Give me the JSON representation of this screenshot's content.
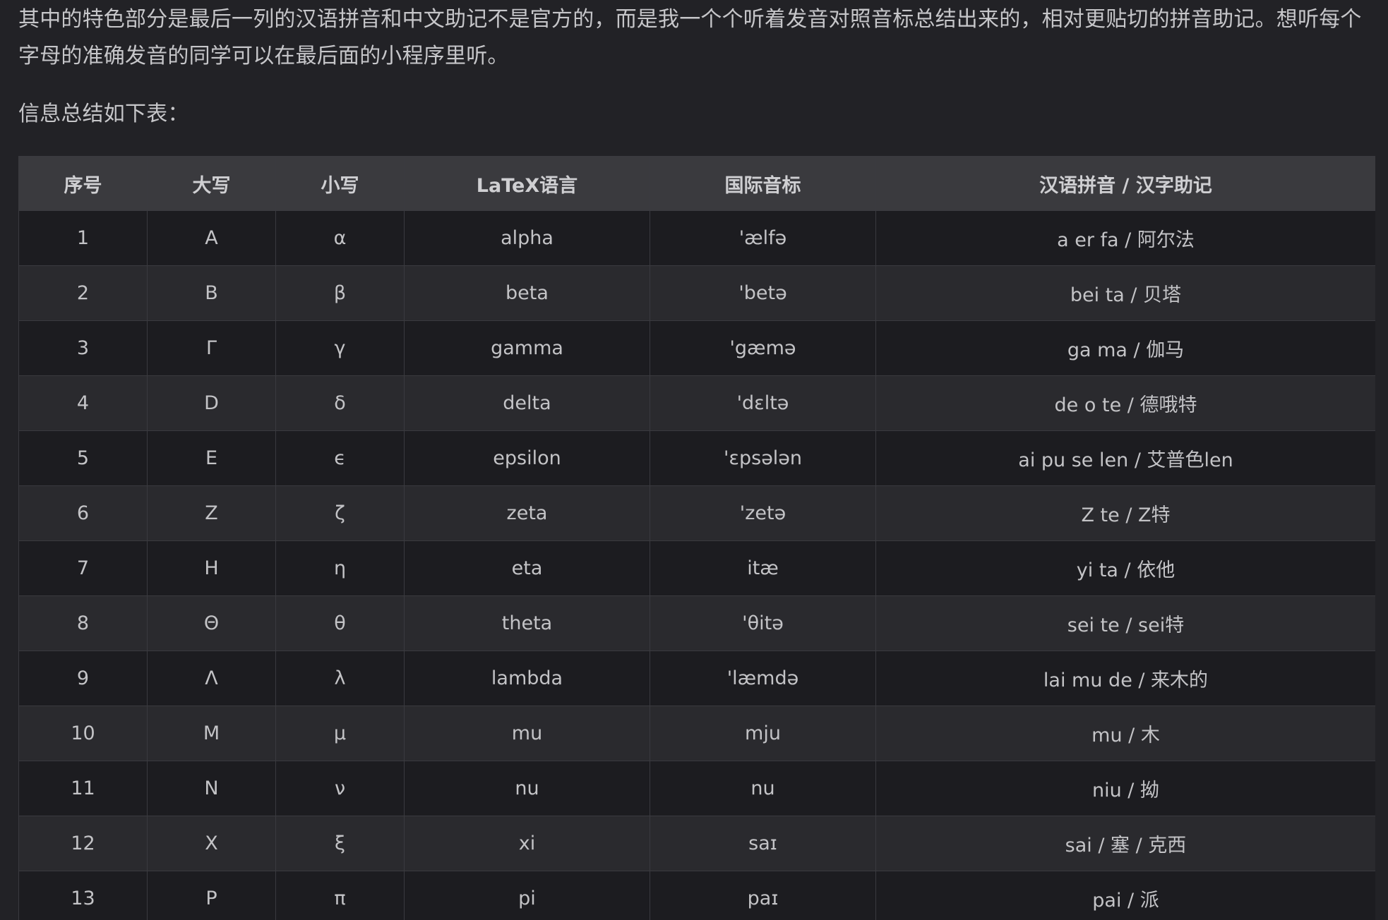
{
  "intro": {
    "paragraph_1": "其中的特色部分是最后一列的汉语拼音和中文助记不是官方的，而是我一个个听着发音对照音标总结出来的，相对更贴切的拼音助记。想听每个字母的准确发音的同学可以在最后面的小程序里听。",
    "paragraph_2": "信息总结如下表："
  },
  "table": {
    "headers": [
      "序号",
      "大写",
      "小写",
      "LaTeX语言",
      "国际音标",
      "汉语拼音 / 汉字助记"
    ],
    "rows": [
      [
        "1",
        "A",
        "α",
        "alpha",
        "'ælfə",
        "a er fa / 阿尔法"
      ],
      [
        "2",
        "B",
        "β",
        "beta",
        "'betə",
        "bei ta / 贝塔"
      ],
      [
        "3",
        "Γ",
        "γ",
        "gamma",
        "'gæmə",
        "ga ma / 伽马"
      ],
      [
        "4",
        "D",
        "δ",
        "delta",
        "'dɛltə",
        "de o te / 德哦特"
      ],
      [
        "5",
        "E",
        "ϵ",
        "epsilon",
        "'ɛpsələn",
        "ai pu se len / 艾普色len"
      ],
      [
        "6",
        "Z",
        "ζ",
        "zeta",
        "'zetə",
        "Z te / Z特"
      ],
      [
        "7",
        "H",
        "η",
        "eta",
        "itæ",
        "yi ta / 依他"
      ],
      [
        "8",
        "Θ",
        "θ",
        "theta",
        "'θitə",
        "sei te / sei特"
      ],
      [
        "9",
        "Λ",
        "λ",
        "lambda",
        "'læmdə",
        "lai mu de / 来木的"
      ],
      [
        "10",
        "M",
        "μ",
        "mu",
        "mju",
        "mu / 木"
      ],
      [
        "11",
        "N",
        "ν",
        "nu",
        "nu",
        "niu / 拗"
      ],
      [
        "12",
        "X",
        "ξ",
        "xi",
        "saɪ",
        "sai / 塞 / 克西"
      ],
      [
        "13",
        "P",
        "π",
        "pi",
        "paɪ",
        "pai / 派"
      ]
    ]
  }
}
